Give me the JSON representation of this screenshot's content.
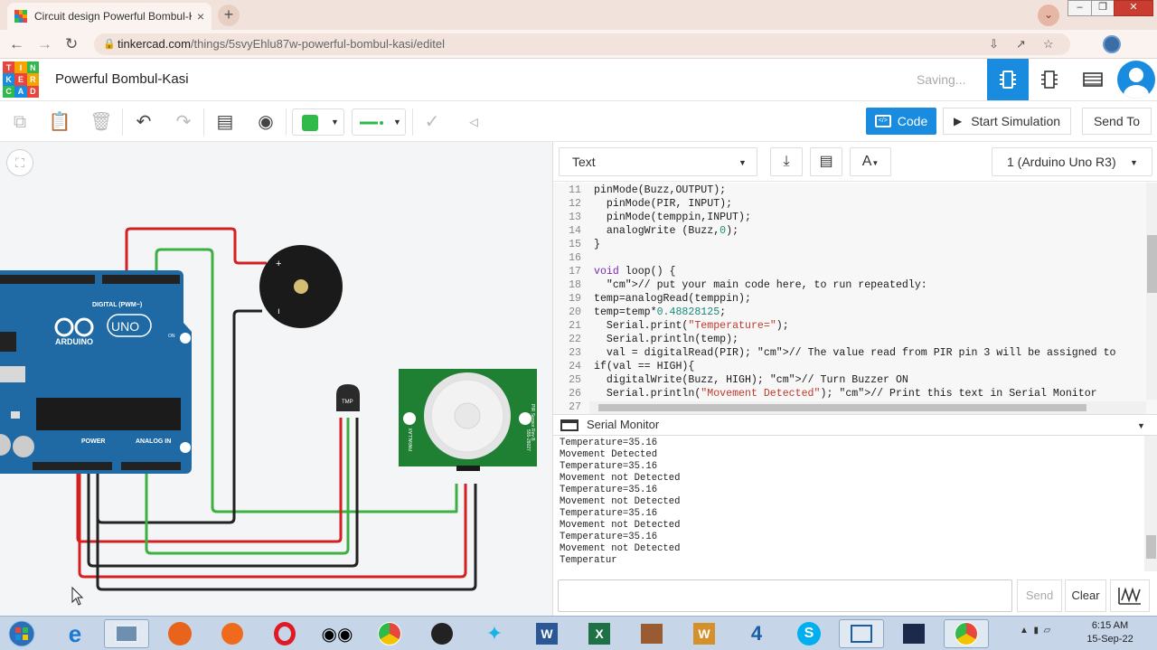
{
  "browser": {
    "tab_title": "Circuit design Powerful Bombul-K",
    "tab_close": "×",
    "new_tab": "+",
    "url_host": "tinkercad.com",
    "url_path": "/things/5svyEhlu87w-powerful-bombul-kasi/editel"
  },
  "header": {
    "logo": [
      "TIN",
      "KER",
      "CAD"
    ],
    "project_name": "Powerful Bombul-Kasi",
    "status": "Saving..."
  },
  "toolbar": {
    "code_label": "Code",
    "start_simulation_label": "Start Simulation",
    "send_to_label": "Send To",
    "fill_color": "#2fba4a",
    "wire_color": "#2fba4a"
  },
  "code_panel": {
    "mode": "Text",
    "device": "1 (Arduino Uno R3)",
    "lines": [
      {
        "n": "11",
        "html": "pinMode(Buzz,OUTPUT);"
      },
      {
        "n": "12",
        "html": "  pinMode(PIR, INPUT);"
      },
      {
        "n": "13",
        "html": "  pinMode(temppin,INPUT);"
      },
      {
        "n": "14",
        "html": "  analogWrite (Buzz,0);"
      },
      {
        "n": "15",
        "html": "}"
      },
      {
        "n": "16",
        "html": ""
      },
      {
        "n": "17",
        "html": "void loop() {"
      },
      {
        "n": "18",
        "html": "  // put your main code here, to run repeatedly:"
      },
      {
        "n": "19",
        "html": "temp=analogRead(temppin);"
      },
      {
        "n": "20",
        "html": "temp=temp*0.48828125;"
      },
      {
        "n": "21",
        "html": "  Serial.print(\"Temperature=\");"
      },
      {
        "n": "22",
        "html": "  Serial.println(temp);"
      },
      {
        "n": "23",
        "html": "  val = digitalRead(PIR); // The value read from PIR pin 3 will be assigned to"
      },
      {
        "n": "24",
        "html": "if(val == HIGH){"
      },
      {
        "n": "25",
        "html": "  digitalWrite(Buzz, HIGH); // Turn Buzzer ON"
      },
      {
        "n": "26",
        "html": "  Serial.println(\"Movement Detected\"); // Print this text in Serial Monitor"
      },
      {
        "n": "27",
        "html": ""
      }
    ]
  },
  "serial_monitor": {
    "title": "Serial Monitor",
    "lines": [
      "Temperature=35.16",
      "Movement Detected",
      "Temperature=35.16",
      "Movement not Detected",
      "Temperature=35.16",
      "Movement not Detected",
      "Temperature=35.16",
      "Movement not Detected",
      "Temperature=35.16",
      "Movement not Detected",
      "Temperatur"
    ],
    "send_label": "Send",
    "clear_label": "Clear"
  },
  "circuit": {
    "board_brand": "ARDUINO",
    "board_model": "UNO",
    "digital_label": "DIGITAL (PWM~)",
    "power_label": "POWER",
    "analog_label": "ANALOG IN",
    "on_label": "ON",
    "tmp_label": "TMP",
    "pir_brand": "PARALLAX",
    "pir_label": "PIR Sensor Rev B",
    "pir_part": "555-28027",
    "buzzer_plus": "+",
    "wire_red": "#d42020",
    "wire_green": "#3cb043",
    "wire_black": "#222222"
  },
  "taskbar": {
    "time": "6:15 AM",
    "date": "15-Sep-22"
  }
}
